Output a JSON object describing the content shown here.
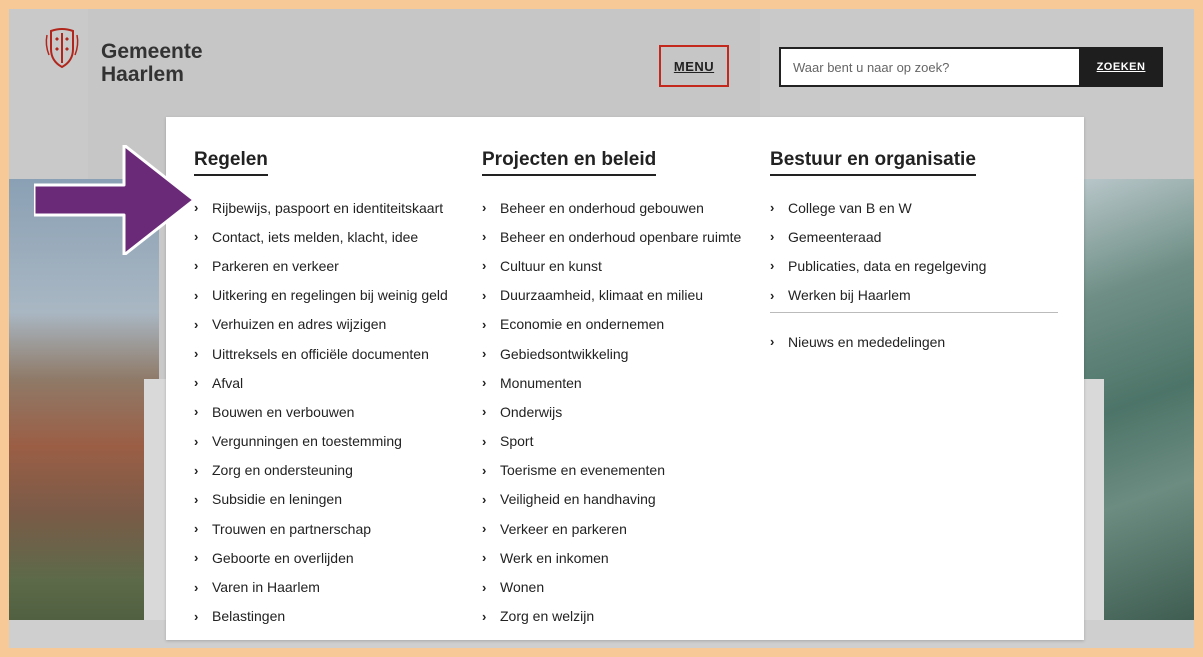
{
  "header": {
    "logo_line1": "Gemeente",
    "logo_line2": "Haarlem",
    "menu_label": "MENU",
    "search_placeholder": "Waar bent u naar op zoek?",
    "search_button": "ZOEKEN"
  },
  "columns": [
    {
      "heading": "Regelen",
      "items": [
        "Rijbewijs, paspoort en identiteitskaart",
        "Contact, iets melden, klacht, idee",
        "Parkeren en verkeer",
        "Uitkering en regelingen bij weinig geld",
        "Verhuizen en adres wijzigen",
        "Uittreksels en officiële documenten",
        "Afval",
        "Bouwen en verbouwen",
        "Vergunningen en toestemming",
        "Zorg en ondersteuning",
        "Subsidie en leningen",
        "Trouwen en partnerschap",
        "Geboorte en overlijden",
        "Varen in Haarlem",
        "Belastingen"
      ]
    },
    {
      "heading": "Projecten en beleid",
      "items": [
        "Beheer en onderhoud gebouwen",
        "Beheer en onderhoud openbare ruimte",
        "Cultuur en kunst",
        "Duurzaamheid, klimaat en milieu",
        "Economie en ondernemen",
        "Gebiedsontwikkeling",
        "Monumenten",
        "Onderwijs",
        "Sport",
        "Toerisme en evenementen",
        "Veiligheid en handhaving",
        "Verkeer en parkeren",
        "Werk en inkomen",
        "Wonen",
        "Zorg en welzijn"
      ]
    },
    {
      "heading": "Bestuur en organisatie",
      "items": [
        "College van B en W",
        "Gemeenteraad",
        "Publicaties, data en regelgeving",
        "Werken bij Haarlem"
      ],
      "extra_item": "Nieuws en mededelingen"
    }
  ],
  "chevron": "›",
  "icons": {
    "logo": "haarlem-coat-of-arms-icon",
    "annotation": "purple-arrow-icon"
  },
  "colors": {
    "accent_red": "#c4271c",
    "annotation_purple": "#6a2a78",
    "frame_orange": "#f7c996"
  }
}
